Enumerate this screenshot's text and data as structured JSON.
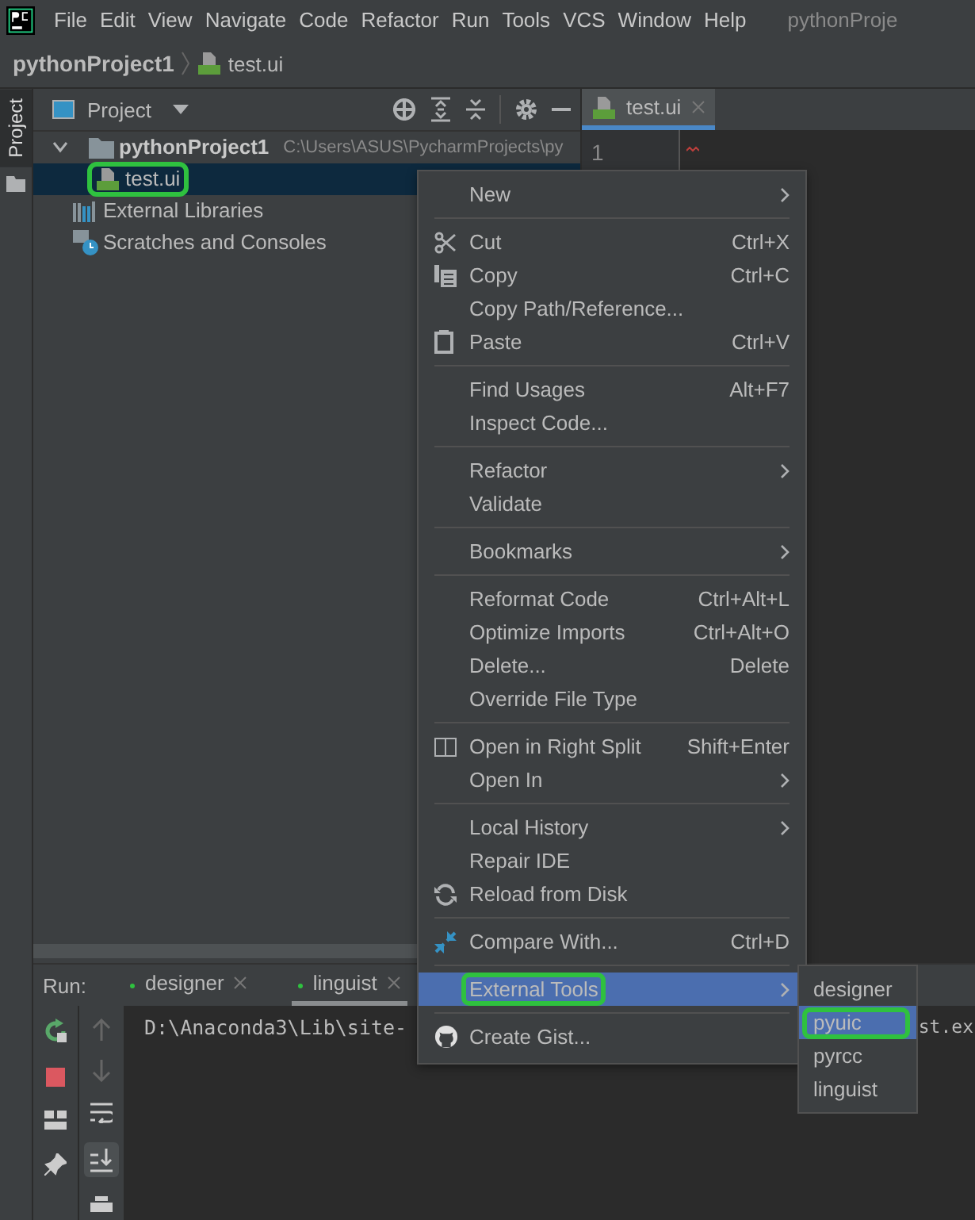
{
  "menu_bar": {
    "items": [
      "File",
      "Edit",
      "View",
      "Navigate",
      "Code",
      "Refactor",
      "Run",
      "Tools",
      "VCS",
      "Window",
      "Help"
    ],
    "title": "pythonProje"
  },
  "breadcrumb": {
    "project": "pythonProject1",
    "file": "test.ui"
  },
  "side_tabs": [
    {
      "label": "Project",
      "selected": true
    }
  ],
  "project_panel": {
    "title": "Project",
    "tree": [
      {
        "kind": "folder",
        "label": "pythonProject1",
        "path": "C:\\Users\\ASUS\\PycharmProjects\\py",
        "expanded": true,
        "selected": false,
        "annotated": false,
        "children": [
          {
            "kind": "file",
            "label": "test.ui",
            "selected": true,
            "annotated": true
          }
        ]
      },
      {
        "kind": "library",
        "label": "External Libraries",
        "selected": false,
        "annotated": false
      },
      {
        "kind": "scratches",
        "label": "Scratches and Consoles",
        "selected": false,
        "annotated": false
      }
    ]
  },
  "editor": {
    "tabs": [
      {
        "label": "test.ui",
        "selected": true
      }
    ],
    "line_numbers": [
      "1"
    ]
  },
  "run_panel": {
    "label": "Run:",
    "tabs": [
      {
        "label": "designer",
        "selected": false
      },
      {
        "label": "linguist",
        "selected": true
      }
    ],
    "console": [
      "D:\\Anaconda3\\Lib\\site-",
      "st.ex"
    ]
  },
  "context_menu": {
    "items": [
      {
        "kind": "item",
        "label": "New",
        "submenu": true,
        "selected": false,
        "annotated": false
      },
      {
        "kind": "separator"
      },
      {
        "kind": "item",
        "label": "Cut",
        "shortcut": "Ctrl+X",
        "submenu": false,
        "selected": false,
        "annotated": false
      },
      {
        "kind": "item",
        "label": "Copy",
        "shortcut": "Ctrl+C",
        "submenu": false,
        "selected": false,
        "annotated": false
      },
      {
        "kind": "item",
        "label": "Copy Path/Reference...",
        "submenu": false,
        "selected": false,
        "annotated": false
      },
      {
        "kind": "item",
        "label": "Paste",
        "shortcut": "Ctrl+V",
        "submenu": false,
        "selected": false,
        "annotated": false
      },
      {
        "kind": "separator"
      },
      {
        "kind": "item",
        "label": "Find Usages",
        "shortcut": "Alt+F7",
        "submenu": false,
        "selected": false,
        "annotated": false
      },
      {
        "kind": "item",
        "label": "Inspect Code...",
        "submenu": false,
        "selected": false,
        "annotated": false
      },
      {
        "kind": "separator"
      },
      {
        "kind": "item",
        "label": "Refactor",
        "submenu": true,
        "selected": false,
        "annotated": false
      },
      {
        "kind": "item",
        "label": "Validate",
        "submenu": false,
        "selected": false,
        "annotated": false
      },
      {
        "kind": "separator"
      },
      {
        "kind": "item",
        "label": "Bookmarks",
        "submenu": true,
        "selected": false,
        "annotated": false
      },
      {
        "kind": "separator"
      },
      {
        "kind": "item",
        "label": "Reformat Code",
        "shortcut": "Ctrl+Alt+L",
        "submenu": false,
        "selected": false,
        "annotated": false
      },
      {
        "kind": "item",
        "label": "Optimize Imports",
        "shortcut": "Ctrl+Alt+O",
        "submenu": false,
        "selected": false,
        "annotated": false
      },
      {
        "kind": "item",
        "label": "Delete...",
        "shortcut": "Delete",
        "submenu": false,
        "selected": false,
        "annotated": false
      },
      {
        "kind": "item",
        "label": "Override File Type",
        "submenu": false,
        "selected": false,
        "annotated": false
      },
      {
        "kind": "separator"
      },
      {
        "kind": "item",
        "label": "Open in Right Split",
        "shortcut": "Shift+Enter",
        "submenu": false,
        "selected": false,
        "annotated": false
      },
      {
        "kind": "item",
        "label": "Open In",
        "submenu": true,
        "selected": false,
        "annotated": false
      },
      {
        "kind": "separator"
      },
      {
        "kind": "item",
        "label": "Local History",
        "submenu": true,
        "selected": false,
        "annotated": false
      },
      {
        "kind": "item",
        "label": "Repair IDE",
        "submenu": false,
        "selected": false,
        "annotated": false
      },
      {
        "kind": "item",
        "label": "Reload from Disk",
        "submenu": false,
        "selected": false,
        "annotated": false
      },
      {
        "kind": "separator"
      },
      {
        "kind": "item",
        "label": "Compare With...",
        "shortcut": "Ctrl+D",
        "submenu": false,
        "selected": false,
        "annotated": false
      },
      {
        "kind": "separator"
      },
      {
        "kind": "item",
        "label": "External Tools",
        "submenu": true,
        "selected": true,
        "annotated": true
      },
      {
        "kind": "separator"
      },
      {
        "kind": "item",
        "label": "Create Gist...",
        "submenu": false,
        "selected": false,
        "annotated": false
      }
    ]
  },
  "submenu": {
    "items": [
      {
        "label": "designer",
        "selected": false,
        "annotated": false
      },
      {
        "label": "pyuic",
        "selected": true,
        "annotated": true
      },
      {
        "label": "pyrcc",
        "selected": false,
        "annotated": false
      },
      {
        "label": "linguist",
        "selected": false,
        "annotated": false
      }
    ]
  }
}
